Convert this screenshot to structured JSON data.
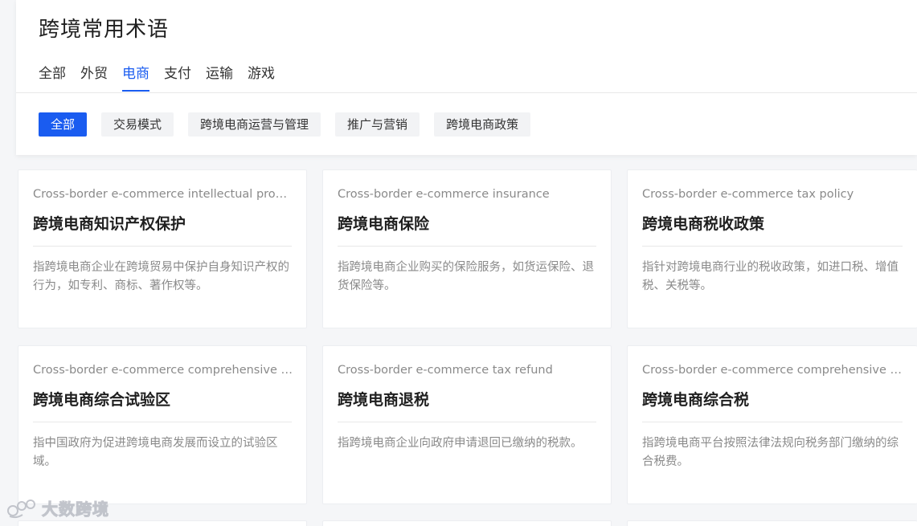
{
  "page": {
    "title": "跨境常用术语"
  },
  "tabs": [
    {
      "label": "全部",
      "active": false
    },
    {
      "label": "外贸",
      "active": false
    },
    {
      "label": "电商",
      "active": true
    },
    {
      "label": "支付",
      "active": false
    },
    {
      "label": "运输",
      "active": false
    },
    {
      "label": "游戏",
      "active": false
    }
  ],
  "chips": [
    {
      "label": "全部",
      "active": true
    },
    {
      "label": "交易模式",
      "active": false
    },
    {
      "label": "跨境电商运营与管理",
      "active": false
    },
    {
      "label": "推广与营销",
      "active": false
    },
    {
      "label": "跨境电商政策",
      "active": false
    }
  ],
  "cards": [
    {
      "en": "Cross-border e-commerce intellectual property protection",
      "zh": "跨境电商知识产权保护",
      "desc": "指跨境电商企业在跨境贸易中保护自身知识产权的行为，如专利、商标、著作权等。"
    },
    {
      "en": "Cross-border e-commerce insurance",
      "zh": "跨境电商保险",
      "desc": "指跨境电商企业购买的保险服务，如货运保险、退货保险等。"
    },
    {
      "en": "Cross-border e-commerce tax policy",
      "zh": "跨境电商税收政策",
      "desc": "指针对跨境电商行业的税收政策，如进口税、增值税、关税等。"
    },
    {
      "en": "Cross-border e-commerce comprehensive test zone",
      "zh": "跨境电商综合试验区",
      "desc": "指中国政府为促进跨境电商发展而设立的试验区域。"
    },
    {
      "en": "Cross-border e-commerce tax refund",
      "zh": "跨境电商退税",
      "desc": "指跨境电商企业向政府申请退回已缴纳的税款。"
    },
    {
      "en": "Cross-border e-commerce comprehensive tax",
      "zh": "跨境电商综合税",
      "desc": "指跨境电商平台按照法律法规向税务部门缴纳的综合税费。"
    }
  ],
  "watermark": {
    "text": "大数跨境"
  },
  "colors": {
    "accent": "#1a5cf0",
    "chip_bg": "#f2f3f5",
    "muted_text": "#8a8a8a"
  }
}
